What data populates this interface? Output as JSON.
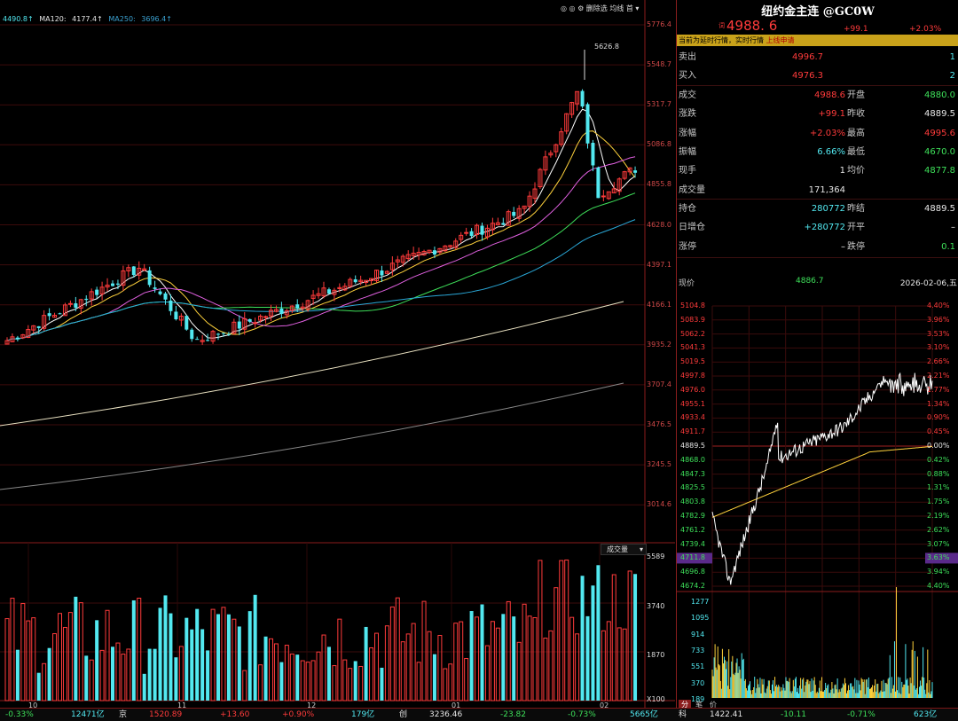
{
  "ma_legend": {
    "ma60": "4490.8↑",
    "ma120_label": "MA120:",
    "ma120": "4177.4↑",
    "ma250_label": "MA250:",
    "ma250": "3696.4↑"
  },
  "toolbar": {
    "delete_label": "删除选",
    "average_label": "均线",
    "first_label": "首"
  },
  "price_axis": [
    "5776.4",
    "5548.7",
    "5317.7",
    "5086.8",
    "4855.8",
    "4628.0",
    "4397.1",
    "4166.1",
    "3935.2",
    "3707.4",
    "3476.5",
    "3245.5",
    "3014.6"
  ],
  "peak_label": "5626.8",
  "volume_axis": [
    "5589",
    "3740",
    "1870",
    "X100"
  ],
  "volume_selector": "成交量",
  "month_labels": [
    "10",
    "11",
    "12",
    "01",
    "02"
  ],
  "header": {
    "title": "纽约金主连 @GC0W",
    "price_tag": "词",
    "price": "4988. 6",
    "change": "+99.1",
    "change_pct": "+2.03%"
  },
  "notice": {
    "text": "当前为延时行情，实时行情",
    "link": "上线申请"
  },
  "orderbook": {
    "sell_label": "卖出",
    "sell_price": "4996.7",
    "sell_vol": "1",
    "buy_label": "买入",
    "buy_price": "4976.3",
    "buy_vol": "2"
  },
  "stats": [
    {
      "l1": "成交",
      "v1": "4988.6",
      "l2": "开盘",
      "v2": "4880.0",
      "c1": "red",
      "c2": "green"
    },
    {
      "l1": "涨跌",
      "v1": "+99.1",
      "l2": "昨收",
      "v2": "4889.5",
      "c1": "red",
      "c2": "white"
    },
    {
      "l1": "涨幅",
      "v1": "+2.03%",
      "l2": "最高",
      "v2": "4995.6",
      "c1": "red",
      "c2": "red"
    },
    {
      "l1": "振幅",
      "v1": "6.66%",
      "l2": "最低",
      "v2": "4670.0",
      "c1": "cyan",
      "c2": "green"
    },
    {
      "l1": "现手",
      "v1": "1",
      "l2": "均价",
      "v2": "4877.8",
      "c1": "white",
      "c2": "green"
    },
    {
      "l1": "成交量",
      "v1": "171,364",
      "l2": "",
      "v2": "",
      "c1": "white",
      "c2": "white"
    }
  ],
  "stats2": [
    {
      "l1": "持仓",
      "v1": "280772",
      "l2": "昨结",
      "v2": "4889.5",
      "c1": "cyan",
      "c2": "white"
    },
    {
      "l1": "日增仓",
      "v1": "+280772",
      "l2": "开平",
      "v2": "–",
      "c1": "cyan",
      "c2": "white"
    },
    {
      "l1": "涨停",
      "v1": "–",
      "l2": "跌停",
      "v2": "0.1",
      "c1": "white",
      "c2": "green"
    }
  ],
  "intraday": {
    "now_label": "现价",
    "now_price": "4886.7",
    "date": "2026-02-06,五",
    "price_axis": [
      "5104.8",
      "5083.9",
      "5062.2",
      "5041.3",
      "5019.5",
      "4997.8",
      "4976.0",
      "4955.1",
      "4933.4",
      "4911.7",
      "4889.5",
      "4868.0",
      "4847.3",
      "4825.5",
      "4803.8",
      "4782.9",
      "4761.2",
      "4739.4",
      "4711.8",
      "4696.8",
      "4674.2"
    ],
    "pct_axis": [
      "4.40%",
      "3.96%",
      "3.53%",
      "3.10%",
      "2.66%",
      "2.21%",
      "1.77%",
      "1.34%",
      "0.90%",
      "0.45%",
      "0.00%",
      "0.42%",
      "0.88%",
      "1.31%",
      "1.75%",
      "2.19%",
      "2.62%",
      "3.07%",
      "3.63%",
      "3.94%",
      "4.40%"
    ],
    "vol_axis": [
      "1277",
      "1095",
      "914",
      "733",
      "551",
      "370",
      "189"
    ],
    "tabs": [
      "分",
      "笔",
      "价"
    ]
  },
  "statusbar": [
    {
      "text": "-0.33%",
      "color": "green"
    },
    {
      "text": "12471亿",
      "color": "cyan"
    },
    {
      "text": "京",
      "color": "white"
    },
    {
      "text": "1520.89",
      "color": "red"
    },
    {
      "text": "+13.60",
      "color": "red"
    },
    {
      "text": "+0.90%",
      "color": "red"
    },
    {
      "text": "179亿",
      "color": "cyan"
    },
    {
      "text": "创",
      "color": "white"
    },
    {
      "text": "3236.46",
      "color": "white"
    },
    {
      "text": "-23.82",
      "color": "green"
    },
    {
      "text": "-0.73%",
      "color": "green"
    },
    {
      "text": "5665亿",
      "color": "cyan"
    },
    {
      "text": "科",
      "color": "white"
    },
    {
      "text": "1422.41",
      "color": "white"
    },
    {
      "text": "-10.11",
      "color": "green"
    },
    {
      "text": "-0.71%",
      "color": "green"
    },
    {
      "text": "623亿",
      "color": "cyan"
    }
  ],
  "colors": {
    "up": "#ff3b3b",
    "down": "#52e8f0",
    "grid": "#5a0d0d",
    "bg": "#000000"
  }
}
